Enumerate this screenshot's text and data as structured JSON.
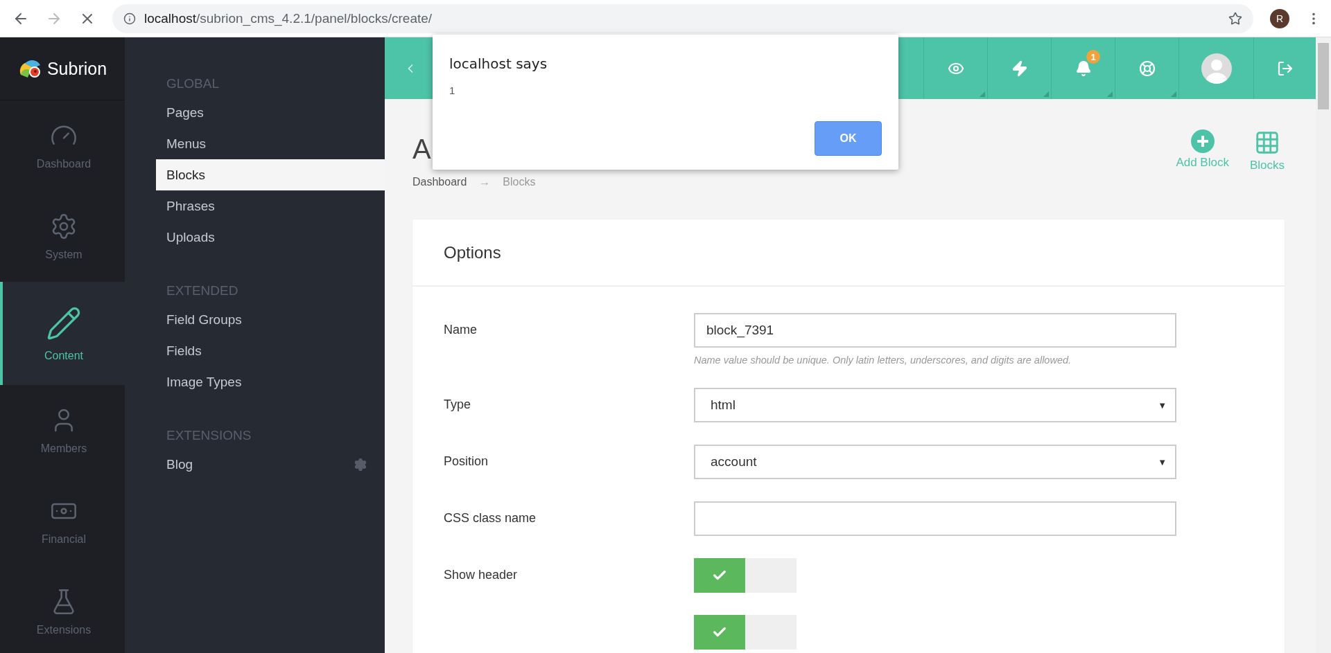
{
  "browser": {
    "url_host": "localhost",
    "url_path": "/subrion_cms_4.2.1/panel/blocks/create/",
    "profile_initial": "R"
  },
  "brand": {
    "name": "Subrion"
  },
  "nav": [
    {
      "label": "Dashboard",
      "selected": false
    },
    {
      "label": "System",
      "selected": false
    },
    {
      "label": "Content",
      "selected": true
    },
    {
      "label": "Members",
      "selected": false
    },
    {
      "label": "Financial",
      "selected": false
    },
    {
      "label": "Extensions",
      "selected": false
    }
  ],
  "subnav": [
    {
      "heading": "GLOBAL",
      "items": [
        {
          "label": "Pages",
          "selected": false
        },
        {
          "label": "Menus",
          "selected": false
        },
        {
          "label": "Blocks",
          "selected": true
        },
        {
          "label": "Phrases",
          "selected": false
        },
        {
          "label": "Uploads",
          "selected": false
        }
      ]
    },
    {
      "heading": "EXTENDED",
      "items": [
        {
          "label": "Field Groups",
          "selected": false
        },
        {
          "label": "Fields",
          "selected": false
        },
        {
          "label": "Image Types",
          "selected": false
        }
      ]
    },
    {
      "heading": "EXTENSIONS",
      "items": [
        {
          "label": "Blog",
          "selected": false,
          "settings": true
        }
      ]
    }
  ],
  "header": {
    "icons": [
      {
        "menu": true
      },
      {
        "menu": true
      },
      {
        "menu": true,
        "badge": "1"
      },
      {
        "menu": true
      },
      {
        "menu": false
      },
      {
        "menu": false
      }
    ]
  },
  "page": {
    "title": "A",
    "breadcrumb": [
      "Dashboard",
      "Blocks"
    ],
    "breadcrumb_separator": "→",
    "actions": [
      {
        "label": "Add Block"
      },
      {
        "label": "Blocks"
      }
    ]
  },
  "form": {
    "title": "Options",
    "rows": [
      {
        "kind": "text",
        "label": "Name",
        "value": "block_7391",
        "hint": "Name value should be unique. Only latin letters, underscores, and digits are allowed."
      },
      {
        "kind": "select",
        "label": "Type",
        "value": "html",
        "caret": "▼"
      },
      {
        "kind": "select",
        "label": "Position",
        "value": "account",
        "caret": "▼"
      },
      {
        "kind": "text",
        "label": "CSS class name"
      },
      {
        "kind": "toggle",
        "label": "Show header",
        "on": true
      },
      {
        "kind": "toggle",
        "on": true
      }
    ]
  },
  "dialog": {
    "title": "localhost says",
    "message": "1",
    "button": "OK"
  }
}
